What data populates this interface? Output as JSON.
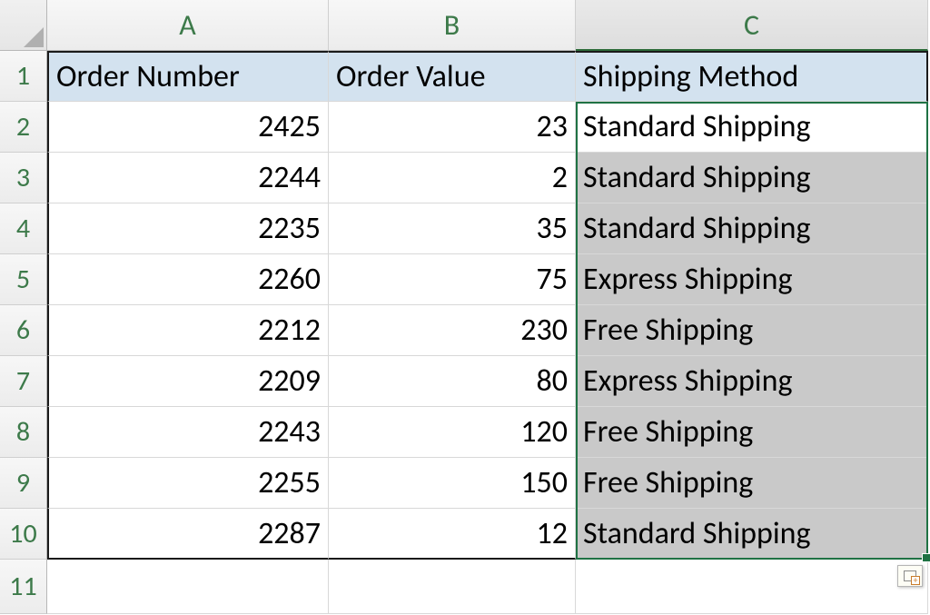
{
  "columns": [
    "A",
    "B",
    "C"
  ],
  "rows": [
    "1",
    "2",
    "3",
    "4",
    "5",
    "6",
    "7",
    "8",
    "9",
    "10",
    "11"
  ],
  "headers": {
    "A": "Order Number",
    "B": "Order Value",
    "C": "Shipping Method"
  },
  "data": [
    {
      "order_number": "2425",
      "order_value": "23",
      "shipping_method": "Standard Shipping"
    },
    {
      "order_number": "2244",
      "order_value": "2",
      "shipping_method": "Standard Shipping"
    },
    {
      "order_number": "2235",
      "order_value": "35",
      "shipping_method": "Standard Shipping"
    },
    {
      "order_number": "2260",
      "order_value": "75",
      "shipping_method": "Express Shipping"
    },
    {
      "order_number": "2212",
      "order_value": "230",
      "shipping_method": "Free Shipping"
    },
    {
      "order_number": "2209",
      "order_value": "80",
      "shipping_method": "Express Shipping"
    },
    {
      "order_number": "2243",
      "order_value": "120",
      "shipping_method": "Free Shipping"
    },
    {
      "order_number": "2255",
      "order_value": "150",
      "shipping_method": "Free Shipping"
    },
    {
      "order_number": "2287",
      "order_value": "12",
      "shipping_method": "Standard Shipping"
    }
  ],
  "selection": {
    "range": "C2:C10",
    "active_cell": "C2"
  },
  "chart_data": {
    "type": "table",
    "columns": [
      "Order Number",
      "Order Value",
      "Shipping Method"
    ],
    "rows": [
      [
        2425,
        23,
        "Standard Shipping"
      ],
      [
        2244,
        2,
        "Standard Shipping"
      ],
      [
        2235,
        35,
        "Standard Shipping"
      ],
      [
        2260,
        75,
        "Express Shipping"
      ],
      [
        2212,
        230,
        "Free Shipping"
      ],
      [
        2209,
        80,
        "Express Shipping"
      ],
      [
        2243,
        120,
        "Free Shipping"
      ],
      [
        2255,
        150,
        "Free Shipping"
      ],
      [
        2287,
        12,
        "Standard Shipping"
      ]
    ]
  }
}
